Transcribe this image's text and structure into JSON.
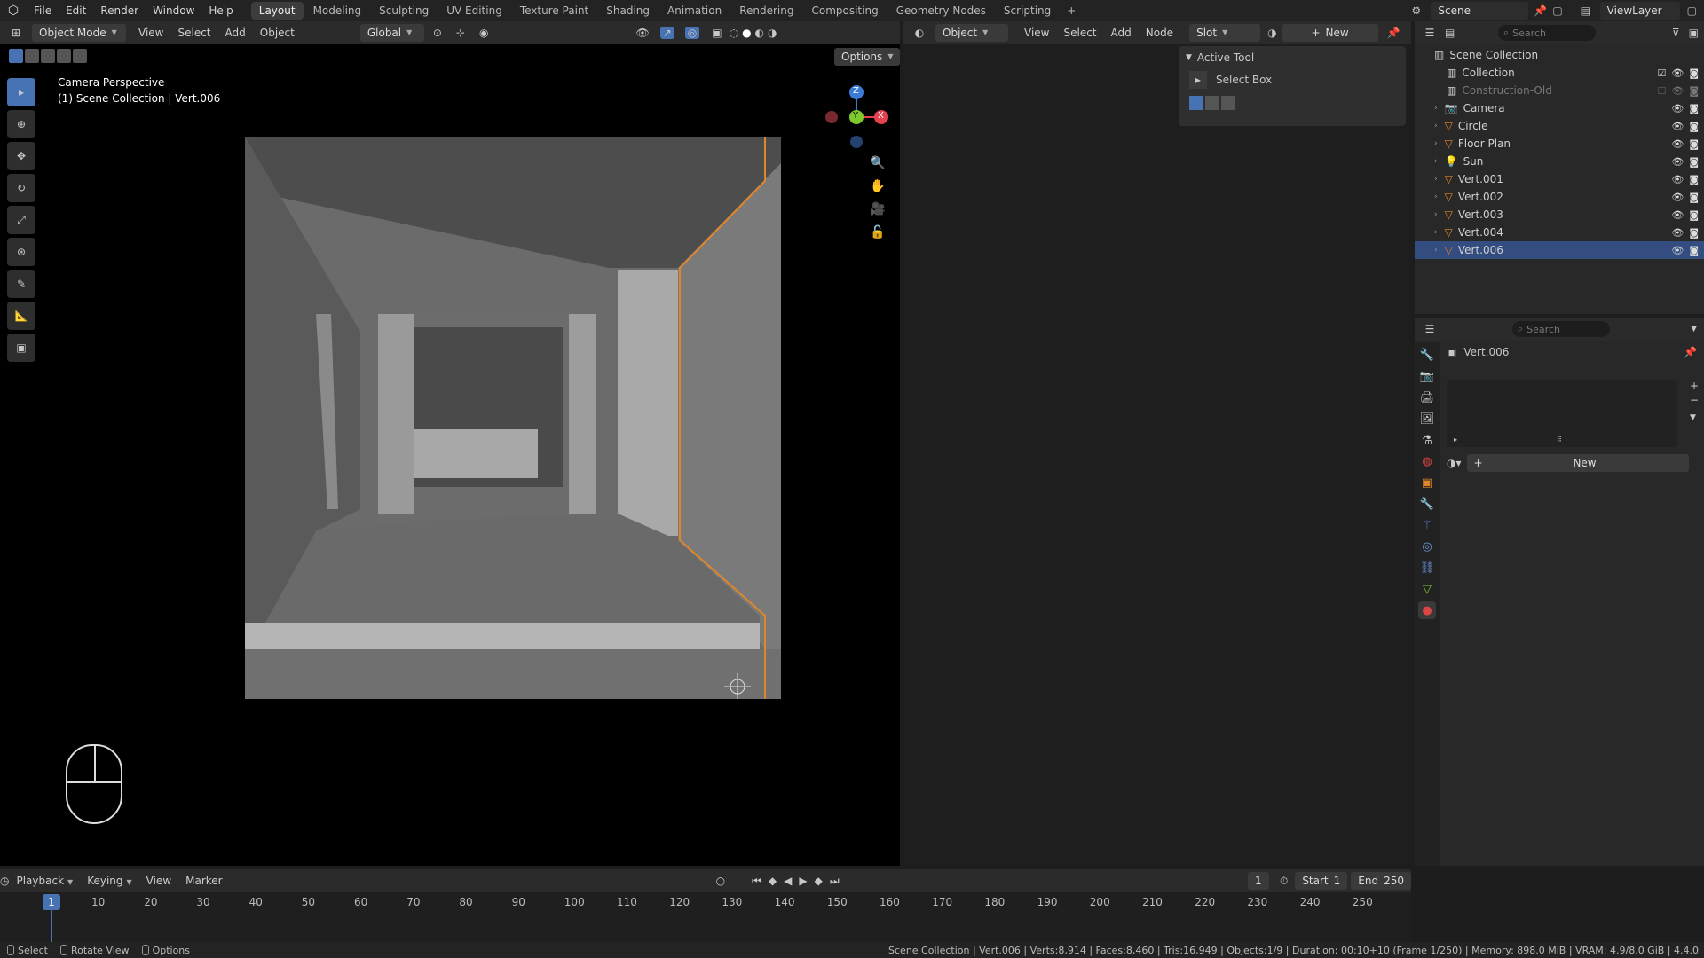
{
  "topbar": {
    "menus": [
      "File",
      "Edit",
      "Render",
      "Window",
      "Help"
    ],
    "workspaces": [
      "Layout",
      "Modeling",
      "Sculpting",
      "UV Editing",
      "Texture Paint",
      "Shading",
      "Animation",
      "Rendering",
      "Compositing",
      "Geometry Nodes",
      "Scripting"
    ],
    "active_workspace": "Layout",
    "add_tab": "+",
    "scene": "Scene",
    "view_layer": "ViewLayer"
  },
  "viewport": {
    "mode": "Object Mode",
    "menus": [
      "View",
      "Select",
      "Add",
      "Object"
    ],
    "orientation": "Global",
    "options": "Options",
    "overlay_title": "Camera Perspective",
    "overlay_sub": "(1) Scene Collection | Vert.006",
    "gizmo": {
      "z": "Z",
      "y": "Y",
      "x": "X"
    }
  },
  "node_editor": {
    "type": "Object",
    "menus": [
      "View",
      "Select",
      "Add",
      "Node"
    ],
    "slot": "Slot",
    "new_label": "New",
    "active_tool_title": "Active Tool",
    "active_tool_name": "Select Box"
  },
  "outliner": {
    "search_placeholder": "Search",
    "root": "Scene Collection",
    "items": [
      {
        "label": "Collection",
        "kind": "collection",
        "checked": true
      },
      {
        "label": "Construction-Old",
        "kind": "collection",
        "checked": false,
        "dim": true
      },
      {
        "label": "Camera",
        "kind": "camera"
      },
      {
        "label": "Circle",
        "kind": "mesh"
      },
      {
        "label": "Floor Plan",
        "kind": "mesh"
      },
      {
        "label": "Sun",
        "kind": "light"
      },
      {
        "label": "Vert.001",
        "kind": "mesh"
      },
      {
        "label": "Vert.002",
        "kind": "mesh"
      },
      {
        "label": "Vert.003",
        "kind": "mesh"
      },
      {
        "label": "Vert.004",
        "kind": "mesh"
      },
      {
        "label": "Vert.006",
        "kind": "mesh",
        "selected": true
      }
    ]
  },
  "properties": {
    "search_placeholder": "Search",
    "object_name": "Vert.006",
    "new_label": "New"
  },
  "timeline": {
    "menus": [
      "Playback",
      "Keying",
      "View",
      "Marker"
    ],
    "current_frame": "1",
    "start_label": "Start",
    "start": "1",
    "end_label": "End",
    "end": "250",
    "ticks": [
      "10",
      "20",
      "30",
      "40",
      "50",
      "60",
      "70",
      "80",
      "90",
      "100",
      "110",
      "120",
      "130",
      "140",
      "150",
      "160",
      "170",
      "180",
      "190",
      "200",
      "210",
      "220",
      "230",
      "240",
      "250"
    ],
    "marker_frame": "1"
  },
  "statusbar": {
    "left": [
      "Select",
      "Rotate View",
      "Options"
    ],
    "right": "Scene Collection | Vert.006 | Verts:8,914 | Faces:8,460 | Tris:16,949 | Objects:1/9 | Duration: 00:10+10 (Frame 1/250) | Memory: 898.0 MiB | VRAM: 4.9/8.0 GiB | 4.4.0"
  },
  "colors": {
    "accent": "#4772b3",
    "selection": "#334d80",
    "outline": "#e0862a",
    "axis_x": "#e5424f",
    "axis_y": "#7ec92e",
    "axis_z": "#3b7bd6"
  }
}
